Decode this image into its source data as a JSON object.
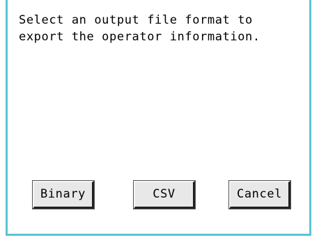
{
  "dialog": {
    "message": "Select an output file format to\nexport the operator information."
  },
  "buttons": {
    "binary_label": "Binary",
    "csv_label": "CSV",
    "cancel_label": "Cancel"
  },
  "colors": {
    "frame": "#59c5d3",
    "background": "#ffffff",
    "button_face": "#e8e8e8"
  }
}
